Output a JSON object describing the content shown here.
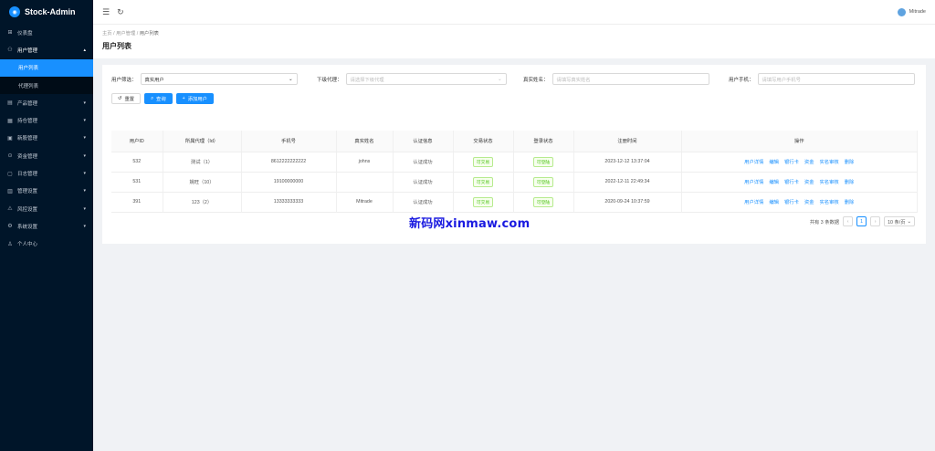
{
  "app": {
    "name": "Stock-Admin"
  },
  "sidebar": {
    "items": [
      {
        "label": "仪表盘",
        "icon": "dashboard-icon"
      },
      {
        "label": "用户管理",
        "icon": "users-icon"
      },
      {
        "label": "用户列表"
      },
      {
        "label": "代理列表"
      },
      {
        "label": "产品管理",
        "icon": "product-icon"
      },
      {
        "label": "持仓管理",
        "icon": "position-icon"
      },
      {
        "label": "新股管理",
        "icon": "ipo-icon"
      },
      {
        "label": "资金管理",
        "icon": "fund-icon"
      },
      {
        "label": "日志管理",
        "icon": "log-icon"
      },
      {
        "label": "管理设置",
        "icon": "admin-settings-icon"
      },
      {
        "label": "风控设置",
        "icon": "risk-icon"
      },
      {
        "label": "系统设置",
        "icon": "system-settings-icon"
      },
      {
        "label": "个人中心",
        "icon": "profile-icon"
      }
    ]
  },
  "header": {
    "user": "Mitrade"
  },
  "breadcrumb": {
    "home": "主页",
    "sep": "/",
    "parent": "用户管理",
    "current": "用户列表"
  },
  "page": {
    "title": "用户列表"
  },
  "filters": {
    "user_filter_label": "用户筛选：",
    "user_filter_value": "真实用户",
    "agent_label": "下级代理：",
    "agent_placeholder": "请选择下级代理",
    "name_label": "真实姓名：",
    "name_placeholder": "请填写真实姓名",
    "phone_label": "用户手机：",
    "phone_placeholder": "请填写用户手机号"
  },
  "buttons": {
    "reset": "重置",
    "search": "查询",
    "add": "添加用户"
  },
  "table": {
    "headers": [
      "用户ID",
      "所属代理（Id）",
      "手机号",
      "真实姓名",
      "认证信息",
      "交易状态",
      "登录状态",
      "注册时间",
      "操作"
    ],
    "rows": [
      {
        "id": "532",
        "agent": "测试（1）",
        "phone": "8612222222222",
        "name": "johns",
        "auth": "认证成功",
        "trade": "可交易",
        "login": "可登陆",
        "time": "2023-12-12 13:37:04"
      },
      {
        "id": "531",
        "agent": "姚旺（10）",
        "phone": "19100000000",
        "name": "",
        "auth": "认证成功",
        "trade": "可交易",
        "login": "可登陆",
        "time": "2022-12-11 22:49:34"
      },
      {
        "id": "391",
        "agent": "123（2）",
        "phone": "13333333333",
        "name": "Mitrade",
        "auth": "认证成功",
        "trade": "可交易",
        "login": "可登陆",
        "time": "2020-09-24 10:37:59"
      }
    ],
    "actions": [
      "用户详情",
      "编辑",
      "银行卡",
      "资金",
      "实名审核",
      "删除"
    ]
  },
  "pagination": {
    "total": "共有 3 条数据",
    "page": "1",
    "page_size": "10 条/页"
  },
  "watermark": "新码网xinmaw.com",
  "colors": {
    "sidebar": "#001529",
    "accent": "#1890ff",
    "success": "#52c41a",
    "watermark": "#1a1ae0"
  }
}
